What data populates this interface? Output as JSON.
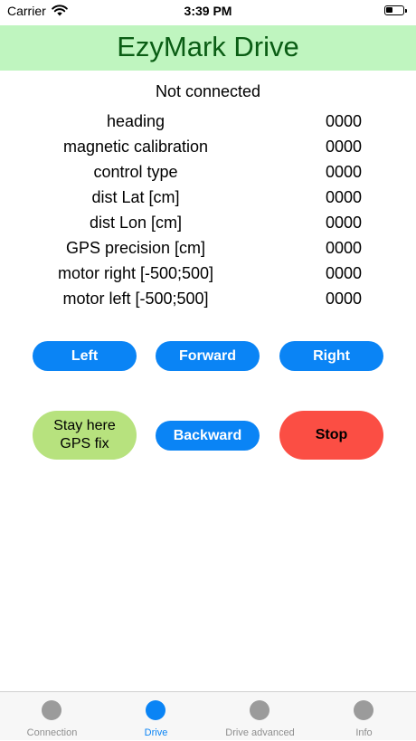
{
  "status_bar": {
    "carrier": "Carrier",
    "time": "3:39 PM"
  },
  "header": {
    "title": "EzyMark Drive"
  },
  "connection_status": "Not connected",
  "telemetry": [
    {
      "label": "heading",
      "value": "0000"
    },
    {
      "label": "magnetic calibration",
      "value": "0000"
    },
    {
      "label": "control type",
      "value": "0000"
    },
    {
      "label": "dist Lat [cm]",
      "value": "0000"
    },
    {
      "label": "dist Lon [cm]",
      "value": "0000"
    },
    {
      "label": "GPS precision [cm]",
      "value": "0000"
    },
    {
      "label": "motor right [-500;500]",
      "value": "0000"
    },
    {
      "label": "motor left [-500;500]",
      "value": "0000"
    }
  ],
  "controls": {
    "left": "Left",
    "forward": "Forward",
    "right": "Right",
    "stay_line1": "Stay here",
    "stay_line2": "GPS fix",
    "backward": "Backward",
    "stop": "Stop"
  },
  "tabs": [
    {
      "label": "Connection",
      "icon": "circle-icon"
    },
    {
      "label": "Drive",
      "icon": "circle-icon",
      "active": true
    },
    {
      "label": "Drive advanced",
      "icon": "circle-icon"
    },
    {
      "label": "Info",
      "icon": "circle-icon"
    }
  ],
  "colors": {
    "accent": "#0a84f5",
    "title_bar": "#bff5bf",
    "title_text": "#0a5d14",
    "stay_button": "#b7e27e",
    "stop_button": "#fb4e44"
  }
}
